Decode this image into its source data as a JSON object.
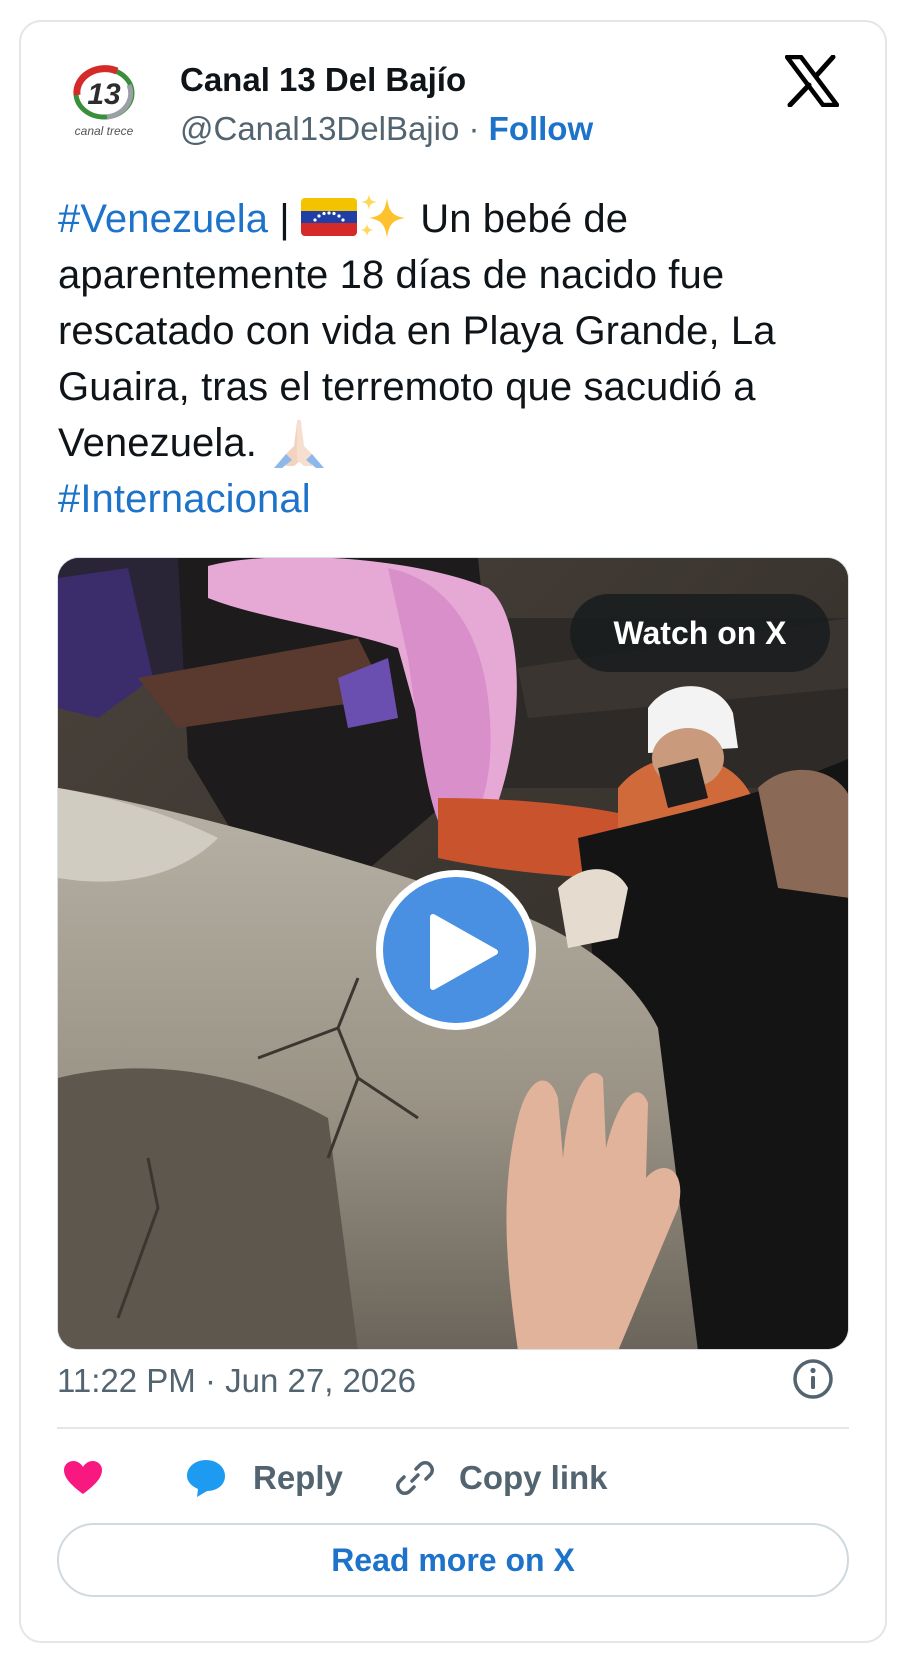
{
  "account": {
    "display_name": "Canal 13 Del Bajío",
    "handle": "@Canal13DelBajio",
    "separator": " · ",
    "follow_label": "Follow",
    "avatar_icon": "canal-trece-logo",
    "avatar_number": "13",
    "avatar_caption": "canal trece"
  },
  "tweet": {
    "hashtag_1": "#Venezuela",
    "pipe": " | ",
    "flag_icon": "venezuela-flag-emoji",
    "sparkles_icon": "sparkles-emoji",
    "body": " Un  bebé de aparentemente 18 días de nacido fue rescatado con vida en Playa Grande, La Guaira, tras el terremoto que sacudió a Venezuela. ",
    "pray_icon": "folded-hands-emoji",
    "hashtag_2": "#Internacional"
  },
  "media": {
    "watch_label": "Watch on X",
    "play_icon": "play-icon"
  },
  "timestamp": "11:22 PM · Jun 27, 2026",
  "actions": {
    "like_icon": "heart-icon",
    "reply_label": "Reply",
    "copy_label": "Copy link"
  },
  "read_more_label": "Read more on X",
  "colors": {
    "link": "#1d73c9",
    "text": "#0f1419",
    "muted": "#536471",
    "heart": "#f91880",
    "reply_bubble": "#1d9bf0",
    "play_button": "#4a90e2"
  }
}
